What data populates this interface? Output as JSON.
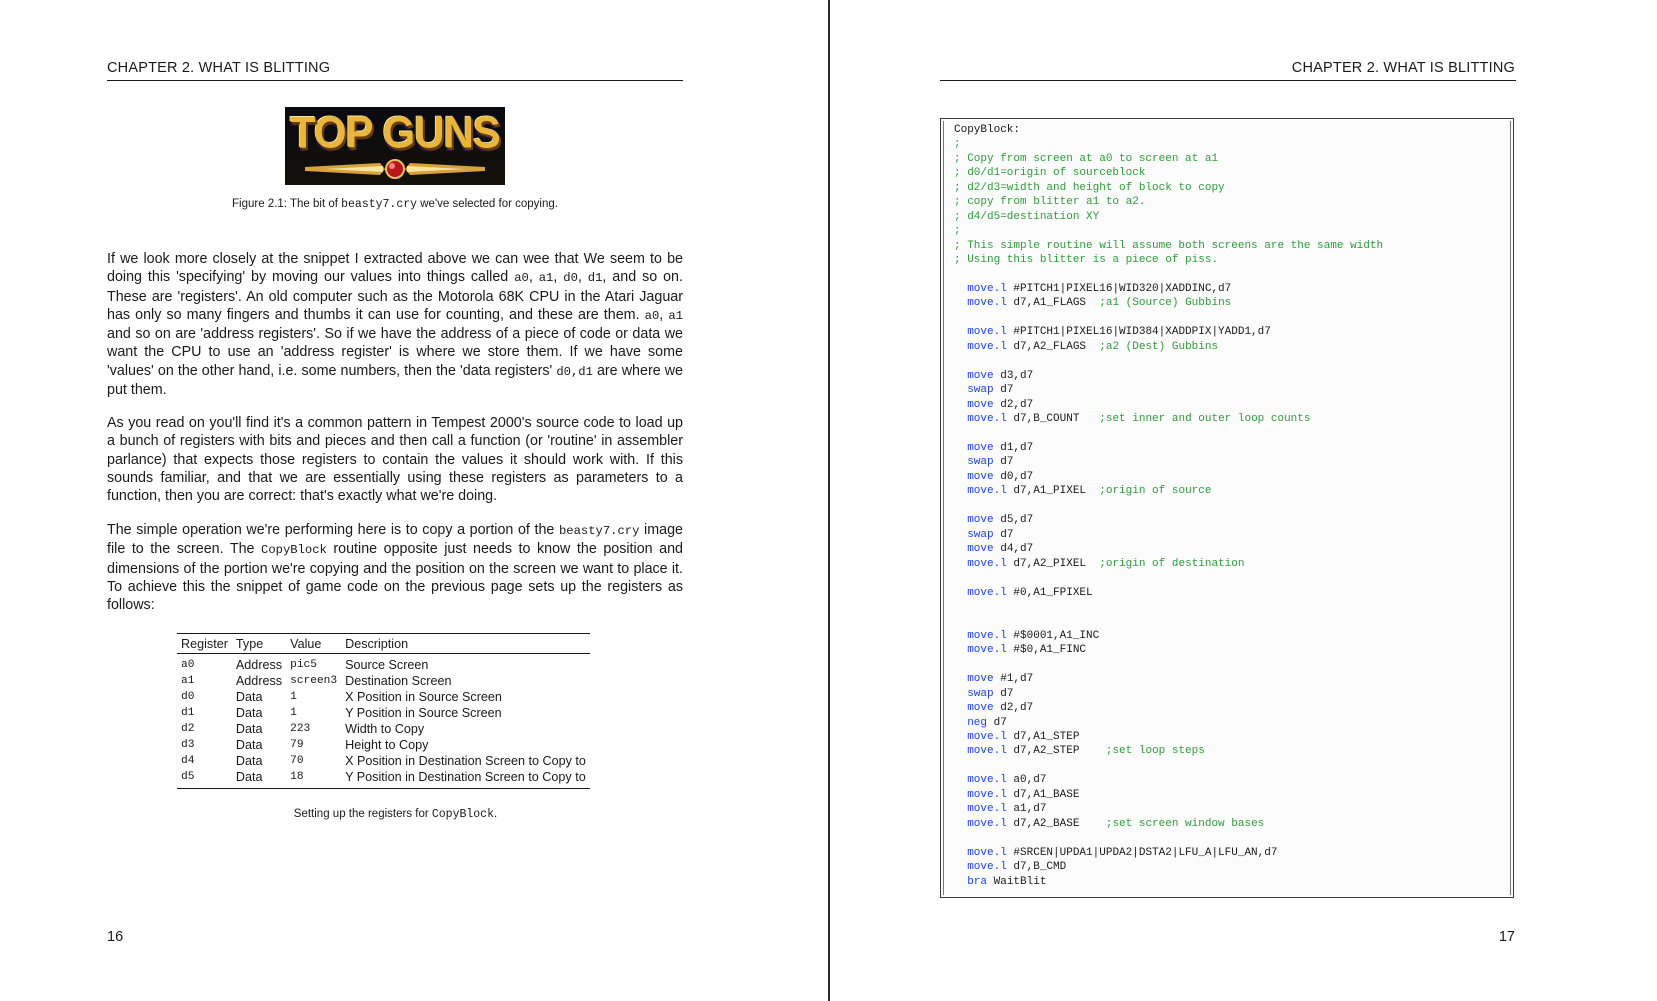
{
  "left_page": {
    "running_head": "CHAPTER 2.  WHAT IS BLITTING",
    "figure": {
      "logo_text": "TOP GUNS",
      "caption_prefix": "Figure 2.1: The bit of ",
      "caption_code": "beasty7.cry",
      "caption_suffix": " we've selected for copying."
    },
    "paragraphs": [
      [
        {
          "t": "text",
          "v": "If we look more closely at the snippet I extracted above we can wee that We seem to be doing this 'specifying' by moving our values into things called "
        },
        {
          "t": "code",
          "v": "a0"
        },
        {
          "t": "text",
          "v": ", "
        },
        {
          "t": "code",
          "v": "a1"
        },
        {
          "t": "text",
          "v": ", "
        },
        {
          "t": "code",
          "v": "d0"
        },
        {
          "t": "text",
          "v": ", "
        },
        {
          "t": "code",
          "v": "d1"
        },
        {
          "t": "text",
          "v": ", and so on. These are 'registers'. An old computer such as the Motorola 68K CPU in the Atari Jaguar has only so many fingers and thumbs it can use for counting, and these are them. "
        },
        {
          "t": "code",
          "v": "a0"
        },
        {
          "t": "text",
          "v": ", "
        },
        {
          "t": "code",
          "v": "a1"
        },
        {
          "t": "text",
          "v": " and so on are 'address registers'. So if we have the address of a piece of code or data we want the CPU to use an 'address register' is where we store them. If we have some 'values' on the other hand, i.e. some numbers, then the 'data registers' "
        },
        {
          "t": "code",
          "v": "d0,d1"
        },
        {
          "t": "text",
          "v": " are where we put them."
        }
      ],
      [
        {
          "t": "text",
          "v": "As you read on you'll find it's a common pattern in Tempest 2000's source code to load up a bunch of registers with bits and pieces and then call a function (or 'routine' in assembler parlance) that expects those registers to contain the values it should work with. If this sounds familiar, and that we are essentially using these registers as parameters to a function, then you are correct: that's exactly what we're doing."
        }
      ],
      [
        {
          "t": "text",
          "v": "The simple operation we're performing here is to copy a portion of the "
        },
        {
          "t": "code",
          "v": "beasty7.cry"
        },
        {
          "t": "text",
          "v": " image file to the screen. The "
        },
        {
          "t": "code",
          "v": "CopyBlock"
        },
        {
          "t": "text",
          "v": " routine opposite just needs to know the position and dimensions of the portion we're copying and the position on the screen we want to place it. To achieve this the snippet of game code on the previous page sets up the registers as follows:"
        }
      ]
    ],
    "table": {
      "headers": [
        "Register",
        "Type",
        "Value",
        "Description"
      ],
      "rows": [
        [
          "a0",
          "Address",
          "pic5",
          "Source Screen"
        ],
        [
          "a1",
          "Address",
          "screen3",
          "Destination Screen"
        ],
        [
          "d0",
          "Data",
          "1",
          "X Position in Source Screen"
        ],
        [
          "d1",
          "Data",
          "1",
          "Y Position in Source Screen"
        ],
        [
          "d2",
          "Data",
          "223",
          "Width to Copy"
        ],
        [
          "d3",
          "Data",
          "79",
          "Height to Copy"
        ],
        [
          "d4",
          "Data",
          "70",
          "X Position in Destination Screen to Copy to"
        ],
        [
          "d5",
          "Data",
          "18",
          "Y Position in Destination Screen to Copy to"
        ]
      ],
      "caption_prefix": "Setting up the registers for ",
      "caption_code": "CopyBlock",
      "caption_suffix": "."
    },
    "page_number": "16"
  },
  "right_page": {
    "running_head": "CHAPTER 2.  WHAT IS BLITTING",
    "page_number": "17",
    "code_lines": [
      {
        "label": "CopyBlock:"
      },
      {
        "comment": ";"
      },
      {
        "comment": "; Copy from screen at a0 to screen at a1"
      },
      {
        "comment": "; d0/d1=origin of sourceblock"
      },
      {
        "comment": "; d2/d3=width and height of block to copy"
      },
      {
        "comment": "; copy from blitter a1 to a2."
      },
      {
        "comment": "; d4/d5=destination XY"
      },
      {
        "comment": ";"
      },
      {
        "comment": "; This simple routine will assume both screens are the same width"
      },
      {
        "comment": "; Using this blitter is a piece of piss."
      },
      {},
      {
        "op": "move.l",
        "args": "#PITCH1|PIXEL16|WID320|XADDINC,d7"
      },
      {
        "op": "move.l",
        "args": "d7,A1_FLAGS",
        "comment": ";a1 (Source) Gubbins",
        "pad": 2
      },
      {},
      {
        "op": "move.l",
        "args": "#PITCH1|PIXEL16|WID384|XADDPIX|YADD1,d7"
      },
      {
        "op": "move.l",
        "args": "d7,A2_FLAGS",
        "comment": ";a2 (Dest) Gubbins",
        "pad": 2
      },
      {},
      {
        "op": "move",
        "args": "d3,d7"
      },
      {
        "op": "swap",
        "args": "d7"
      },
      {
        "op": "move",
        "args": "d2,d7"
      },
      {
        "op": "move.l",
        "args": "d7,B_COUNT",
        "comment": ";set inner and outer loop counts",
        "pad": 3
      },
      {},
      {
        "op": "move",
        "args": "d1,d7"
      },
      {
        "op": "swap",
        "args": "d7"
      },
      {
        "op": "move",
        "args": "d0,d7"
      },
      {
        "op": "move.l",
        "args": "d7,A1_PIXEL",
        "comment": ";origin of source",
        "pad": 2
      },
      {},
      {
        "op": "move",
        "args": "d5,d7"
      },
      {
        "op": "swap",
        "args": "d7"
      },
      {
        "op": "move",
        "args": "d4,d7"
      },
      {
        "op": "move.l",
        "args": "d7,A2_PIXEL",
        "comment": ";origin of destination",
        "pad": 2
      },
      {},
      {
        "op": "move.l",
        "args": "#0,A1_FPIXEL"
      },
      {},
      {},
      {
        "op": "move.l",
        "args": "#$0001,A1_INC"
      },
      {
        "op": "move.l",
        "args": "#$0,A1_FINC"
      },
      {},
      {
        "op": "move",
        "args": "#1,d7"
      },
      {
        "op": "swap",
        "args": "d7"
      },
      {
        "op": "move",
        "args": "d2,d7"
      },
      {
        "op": "neg",
        "args": "d7"
      },
      {
        "op": "move.l",
        "args": "d7,A1_STEP"
      },
      {
        "op": "move.l",
        "args": "d7,A2_STEP",
        "comment": ";set loop steps",
        "pad": 4
      },
      {},
      {
        "op": "move.l",
        "args": "a0,d7"
      },
      {
        "op": "move.l",
        "args": "d7,A1_BASE"
      },
      {
        "op": "move.l",
        "args": "a1,d7"
      },
      {
        "op": "move.l",
        "args": "d7,A2_BASE",
        "comment": ";set screen window bases",
        "pad": 4
      },
      {},
      {
        "op": "move.l",
        "args": "#SRCEN|UPDA1|UPDA2|DSTA2|LFU_A|LFU_AN,d7"
      },
      {
        "op": "move.l",
        "args": "d7,B_CMD"
      },
      {
        "op": "bra",
        "args": "WaitBlit"
      }
    ]
  }
}
